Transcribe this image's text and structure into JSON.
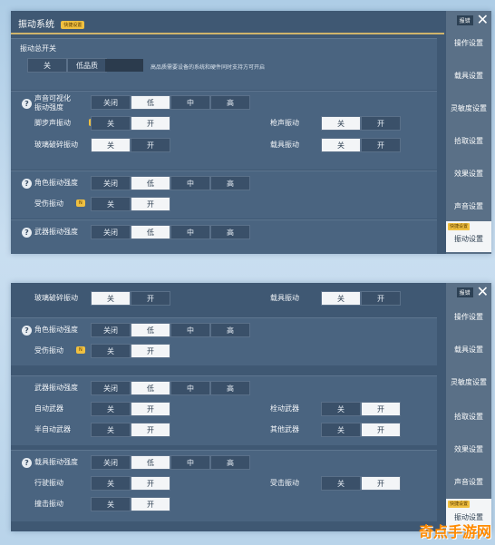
{
  "panel1": {
    "title": "振动系统",
    "title_badge": "快捷设置",
    "sidebar": {
      "top_small": "报错",
      "items": [
        "操作设置",
        "载具设置",
        "灵敏度设置",
        "拾取设置",
        "效果设置",
        "声音设置",
        "振动设置"
      ],
      "active_badge": "快捷设置"
    },
    "master": {
      "label": "振动总开关",
      "options": [
        "关",
        "低品质"
      ],
      "note": "高品质需要设备的系统和硬件同时支持方可开启"
    },
    "sound_viz": {
      "label_line1": "声音可视化",
      "label_line2": "振动强度",
      "options": [
        "关闭",
        "低",
        "中",
        "高"
      ]
    },
    "footstep": {
      "label": "脚步声振动",
      "options": [
        "关",
        "开"
      ]
    },
    "gunshot": {
      "label": "枪声振动",
      "options": [
        "关",
        "开"
      ]
    },
    "glass": {
      "label": "玻璃破碎振动",
      "options": [
        "关",
        "开"
      ]
    },
    "vehicle": {
      "label": "载具振动",
      "options": [
        "关",
        "开"
      ]
    },
    "char_intensity": {
      "label": "角色振动强度",
      "options": [
        "关闭",
        "低",
        "中",
        "高"
      ]
    },
    "hurt": {
      "label": "受伤振动",
      "options": [
        "关",
        "开"
      ]
    },
    "weapon_intensity": {
      "label": "武器振动强度",
      "options": [
        "关闭",
        "低",
        "中",
        "高"
      ]
    }
  },
  "panel2": {
    "sidebar": {
      "top_small": "报错",
      "items": [
        "操作设置",
        "载具设置",
        "灵敏度设置",
        "拾取设置",
        "效果设置",
        "声音设置",
        "振动设置"
      ],
      "active_badge": "快捷设置"
    },
    "glass": {
      "label": "玻璃破碎振动",
      "options": [
        "关",
        "开"
      ]
    },
    "vehicle": {
      "label": "载具振动",
      "options": [
        "关",
        "开"
      ]
    },
    "char_intensity": {
      "label": "角色振动强度",
      "options": [
        "关闭",
        "低",
        "中",
        "高"
      ]
    },
    "hurt": {
      "label": "受伤振动",
      "options": [
        "关",
        "开"
      ]
    },
    "weapon_intensity": {
      "label": "武器振动强度",
      "options": [
        "关闭",
        "低",
        "中",
        "高"
      ]
    },
    "auto_weapon": {
      "label": "自动武器",
      "options": [
        "关",
        "开"
      ]
    },
    "bolt_weapon": {
      "label": "栓动武器",
      "options": [
        "关",
        "开"
      ]
    },
    "semi_weapon": {
      "label": "半自动武器",
      "options": [
        "关",
        "开"
      ]
    },
    "other_weapon": {
      "label": "其他武器",
      "options": [
        "关",
        "开"
      ]
    },
    "vehicle_intensity": {
      "label": "载具振动强度",
      "options": [
        "关闭",
        "低",
        "中",
        "高"
      ]
    },
    "drive": {
      "label": "行驶振动",
      "options": [
        "关",
        "开"
      ]
    },
    "hit_by": {
      "label": "受击振动",
      "options": [
        "关",
        "开"
      ]
    },
    "collision": {
      "label": "撞击振动",
      "options": [
        "关",
        "开"
      ]
    }
  },
  "watermark": "奇点手游网"
}
